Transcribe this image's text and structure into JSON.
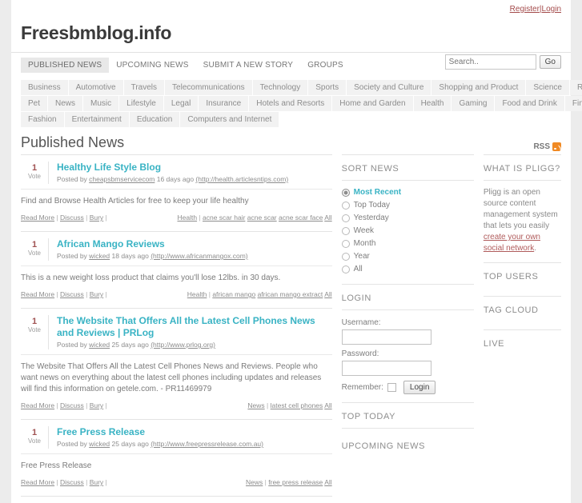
{
  "topbar": {
    "register": "Register",
    "separator": "|",
    "login": "Login"
  },
  "site": {
    "title": "Freesbmblog.info"
  },
  "mainnav": {
    "items": [
      {
        "label": "PUBLISHED NEWS",
        "active": true
      },
      {
        "label": "UPCOMING NEWS",
        "active": false
      },
      {
        "label": "SUBMIT A NEW STORY",
        "active": false
      },
      {
        "label": "GROUPS",
        "active": false
      }
    ]
  },
  "search": {
    "placeholder": "Search..",
    "value": "",
    "go_label": "Go"
  },
  "categories": [
    [
      "Business",
      "Automotive",
      "Travels",
      "Telecommunications",
      "Technology",
      "Sports",
      "Society and Culture",
      "Shopping and Product",
      "Science",
      "Real Estate"
    ],
    [
      "Pet",
      "News",
      "Music",
      "Lifestyle",
      "Legal",
      "Insurance",
      "Hotels and Resorts",
      "Home and Garden",
      "Health",
      "Gaming",
      "Food and Drink",
      "Finance"
    ],
    [
      "Fashion",
      "Entertainment",
      "Education",
      "Computers and Internet"
    ]
  ],
  "page": {
    "heading": "Published News",
    "rss_label": "RSS"
  },
  "stories": [
    {
      "votes": "1",
      "vote_label": "Vote",
      "title": "Healthy Life Style Blog",
      "posted_prefix": "Posted by",
      "author": "cheapsbmservicecom",
      "age": "16 days ago",
      "url": "(http://health.articlesntips.com)",
      "description": "Find and Browse Health Articles for free to keep your life healthy",
      "actions": [
        "Read More",
        "Discuss",
        "Bury"
      ],
      "category": "Health",
      "tags": [
        "acne scar hair",
        "acne scar",
        "acne scar face",
        "All"
      ]
    },
    {
      "votes": "1",
      "vote_label": "Vote",
      "title": "African Mango Reviews",
      "posted_prefix": "Posted by",
      "author": "wicked",
      "age": "18 days ago",
      "url": "(http://www.africanmangox.com)",
      "description": "This is a new weight loss product that claims you'll lose 12lbs. in 30 days.",
      "actions": [
        "Read More",
        "Discuss",
        "Bury"
      ],
      "category": "Health",
      "tags": [
        "african mango",
        "african mango extract",
        "All"
      ]
    },
    {
      "votes": "1",
      "vote_label": "Vote",
      "title": "The Website That Offers All the Latest Cell Phones News and Reviews | PRLog",
      "posted_prefix": "Posted by",
      "author": "wicked",
      "age": "25 days ago",
      "url": "(http://www.prlog.org)",
      "description": "The Website That Offers All the Latest Cell Phones News and Reviews. People who want news on everything about the latest cell phones including updates and releases will find this information on getele.com. - PR11469979",
      "actions": [
        "Read More",
        "Discuss",
        "Bury"
      ],
      "category": "News",
      "tags": [
        "latest cell phones",
        "All"
      ]
    },
    {
      "votes": "1",
      "vote_label": "Vote",
      "title": "Free Press Release",
      "posted_prefix": "Posted by",
      "author": "wicked",
      "age": "25 days ago",
      "url": "(http://www.freepressrelease.com.au)",
      "description": "Free Press Release",
      "actions": [
        "Read More",
        "Discuss",
        "Bury"
      ],
      "category": "News",
      "tags": [
        "free press release",
        "All"
      ]
    }
  ],
  "sort_news": {
    "heading": "SORT NEWS",
    "options": [
      {
        "label": "Most Recent",
        "selected": true
      },
      {
        "label": "Top Today",
        "selected": false
      },
      {
        "label": "Yesterday",
        "selected": false
      },
      {
        "label": "Week",
        "selected": false
      },
      {
        "label": "Month",
        "selected": false
      },
      {
        "label": "Year",
        "selected": false
      },
      {
        "label": "All",
        "selected": false
      }
    ]
  },
  "login_box": {
    "heading": "LOGIN",
    "username_label": "Username:",
    "username_value": "",
    "password_label": "Password:",
    "password_value": "",
    "remember_label": "Remember:",
    "button_label": "Login"
  },
  "top_today": {
    "heading": "TOP TODAY"
  },
  "upcoming_news": {
    "heading": "UPCOMING NEWS"
  },
  "what_is_pligg": {
    "heading": "WHAT IS PLIGG?",
    "text_before": "Pligg is an open source content management system that lets you easily ",
    "link": "create your own social network",
    "text_after": "."
  },
  "top_users": {
    "heading": "TOP USERS"
  },
  "tag_cloud": {
    "heading": "TAG CLOUD"
  },
  "live": {
    "heading": "LIVE"
  },
  "colors": {
    "accent_teal": "#39b3c4",
    "link_red": "#a34a4a",
    "rss_orange": "#f08a24",
    "page_bg": "#ececec"
  }
}
